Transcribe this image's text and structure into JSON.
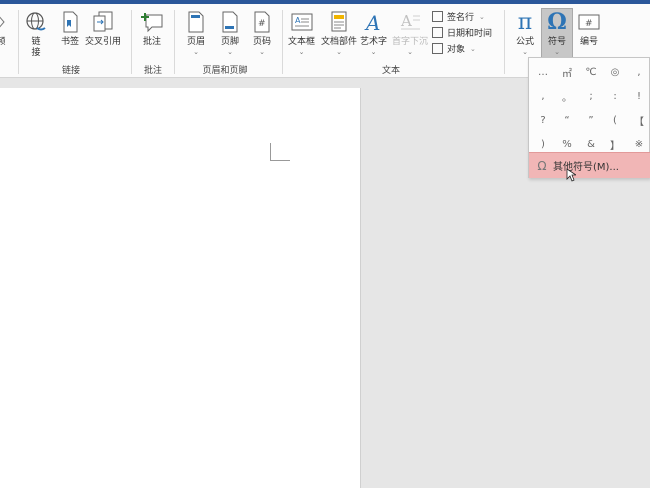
{
  "ribbon": {
    "partial_left_label": "频",
    "buttons": {
      "link": "链接",
      "bookmark": "书签",
      "cross_ref": "交叉引用",
      "comment": "批注",
      "header": "页眉",
      "footer": "页脚",
      "page_number": "页码",
      "textbox": "文本框",
      "doc_parts": "文档部件",
      "wordart": "艺术字",
      "dropcap": "首字下沉",
      "signature": "签名行",
      "datetime": "日期和时间",
      "object": "对象",
      "equation": "公式",
      "symbol": "符号",
      "numbering": "编号"
    },
    "groups": {
      "links": "链接",
      "comments": "批注",
      "header_footer": "页眉和页脚",
      "text": "文本"
    }
  },
  "symbol_menu": {
    "symbols": [
      "…",
      "㎡",
      "℃",
      "◎",
      ",",
      ",",
      "。",
      ";",
      ":",
      "!",
      "?",
      "“",
      "”",
      "(",
      "【",
      ")",
      "%",
      "&",
      "】",
      "※"
    ],
    "more_symbols_label": "其他符号(M)..."
  },
  "colors": {
    "accent": "#2b579a",
    "menu_highlight": "#f1b6b6",
    "icon_blue": "#2e74b5"
  }
}
